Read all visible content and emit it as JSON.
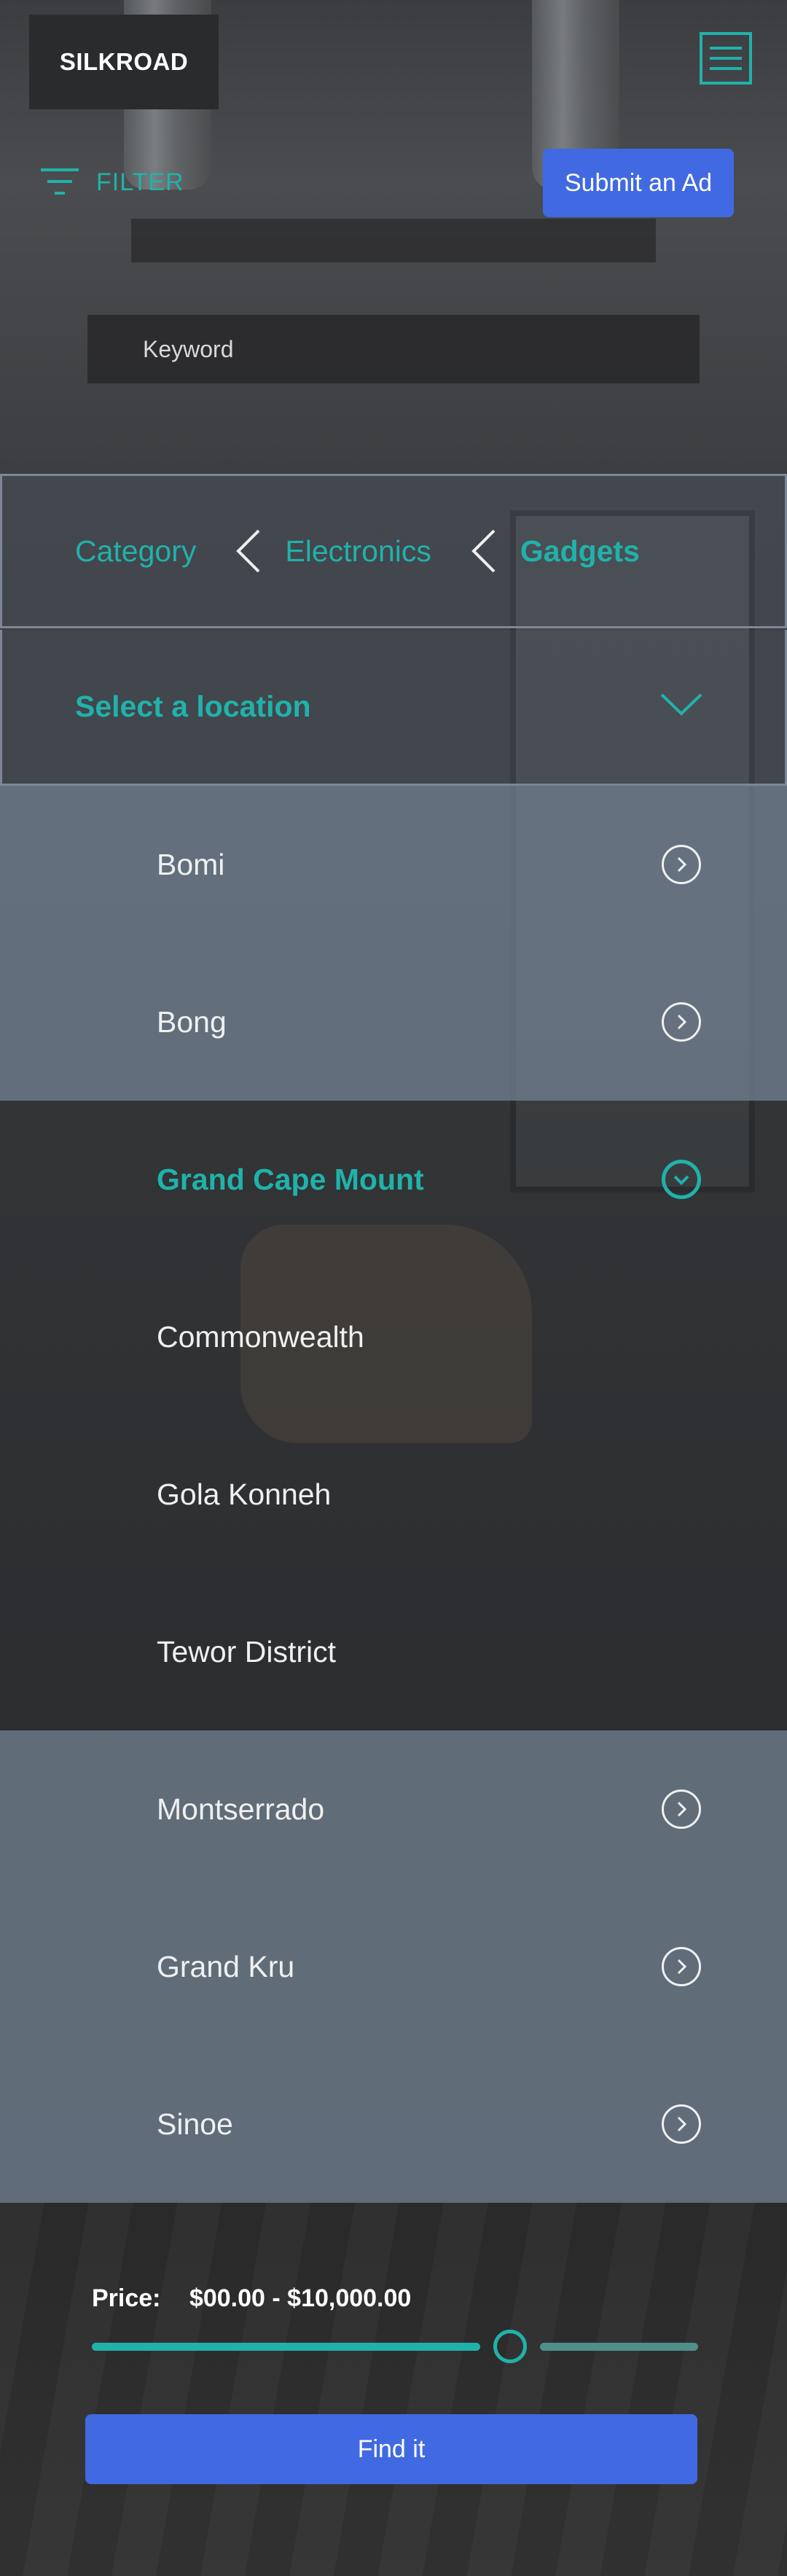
{
  "header": {
    "logo_text": "SILKROAD",
    "filter_label": "FILTER",
    "submit_ad_label": "Submit an Ad"
  },
  "search": {
    "keyword_placeholder": "Keyword"
  },
  "category": {
    "crumbs": [
      "Category",
      "Electronics",
      "Gadgets"
    ]
  },
  "location": {
    "select_label": "Select a location",
    "items": [
      {
        "label": "Bomi",
        "state": "collapsed"
      },
      {
        "label": "Bong",
        "state": "collapsed"
      },
      {
        "label": "Grand Cape Mount",
        "state": "expanded"
      },
      {
        "label": "Commonwealth",
        "state": "sub"
      },
      {
        "label": "Gola Konneh",
        "state": "sub"
      },
      {
        "label": "Tewor District",
        "state": "sub"
      },
      {
        "label": "Montserrado",
        "state": "collapsed"
      },
      {
        "label": "Grand Kru",
        "state": "collapsed"
      },
      {
        "label": "Sinoe",
        "state": "collapsed"
      }
    ]
  },
  "price": {
    "label": "Price:",
    "range_text": "$00.00 - $10,000.00",
    "slider_fraction": 0.69
  },
  "actions": {
    "find_label": "Find it"
  },
  "colors": {
    "accent_teal": "#20b2aa",
    "primary_blue": "#4169e1"
  }
}
